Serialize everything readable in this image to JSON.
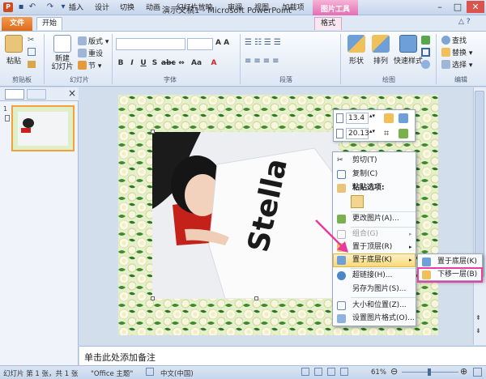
{
  "window": {
    "title": "演示文稿1 - Microsoft PowerPoint",
    "context_tab_group": "图片工具"
  },
  "tabs": [
    "文件",
    "开始",
    "插入",
    "设计",
    "切换",
    "动画",
    "幻灯片放映",
    "审阅",
    "视图",
    "加载项",
    "格式"
  ],
  "ribbon": {
    "clipboard": {
      "paste": "粘贴",
      "group": "剪贴板"
    },
    "slides": {
      "new_slide": "新建\n幻灯片",
      "layout": "版式",
      "reset": "重设",
      "section": "节",
      "group": "幻灯片"
    },
    "font": {
      "group": "字体",
      "size_buttons": "A A"
    },
    "paragraph": {
      "group": "段落"
    },
    "drawing": {
      "shapes": "形状",
      "arrange": "排列",
      "quick_styles": "快速样式",
      "group": "绘图"
    },
    "editing": {
      "find": "查找",
      "replace": "替换",
      "select": "选择",
      "group": "编辑"
    }
  },
  "pane_tabs": {
    "close": "×"
  },
  "slide_thumb": {
    "number": "1"
  },
  "mini_toolbar": {
    "height": "13.4",
    "width": "20.13"
  },
  "photo_text": "Stella",
  "context_menu": {
    "items": [
      {
        "label": "剪切(T)"
      },
      {
        "label": "复制(C)"
      },
      {
        "label": "粘贴选项:"
      },
      {
        "label": "更改图片(A)..."
      },
      {
        "label": "组合(G)"
      },
      {
        "label": "置于顶层(R)"
      },
      {
        "label": "置于底层(K)"
      },
      {
        "label": "超链接(H)..."
      },
      {
        "label": "另存为图片(S)..."
      },
      {
        "label": "大小和位置(Z)..."
      },
      {
        "label": "设置图片格式(O)..."
      }
    ],
    "submenu": [
      {
        "label": "置于底层(K)"
      },
      {
        "label": "下移一层(B)"
      }
    ]
  },
  "notes": {
    "placeholder": "单击此处添加备注"
  },
  "status": {
    "slide": "幻灯片 第 1 张，共 1 张",
    "theme": "\"Office 主题\"",
    "language": "中文(中国)",
    "zoom": "61%"
  },
  "colors": {
    "accent_orange": "#de6b1d",
    "context_pink": "#e36fb4",
    "highlight_box": "#e83fa7",
    "arrow": "#e8399f"
  }
}
